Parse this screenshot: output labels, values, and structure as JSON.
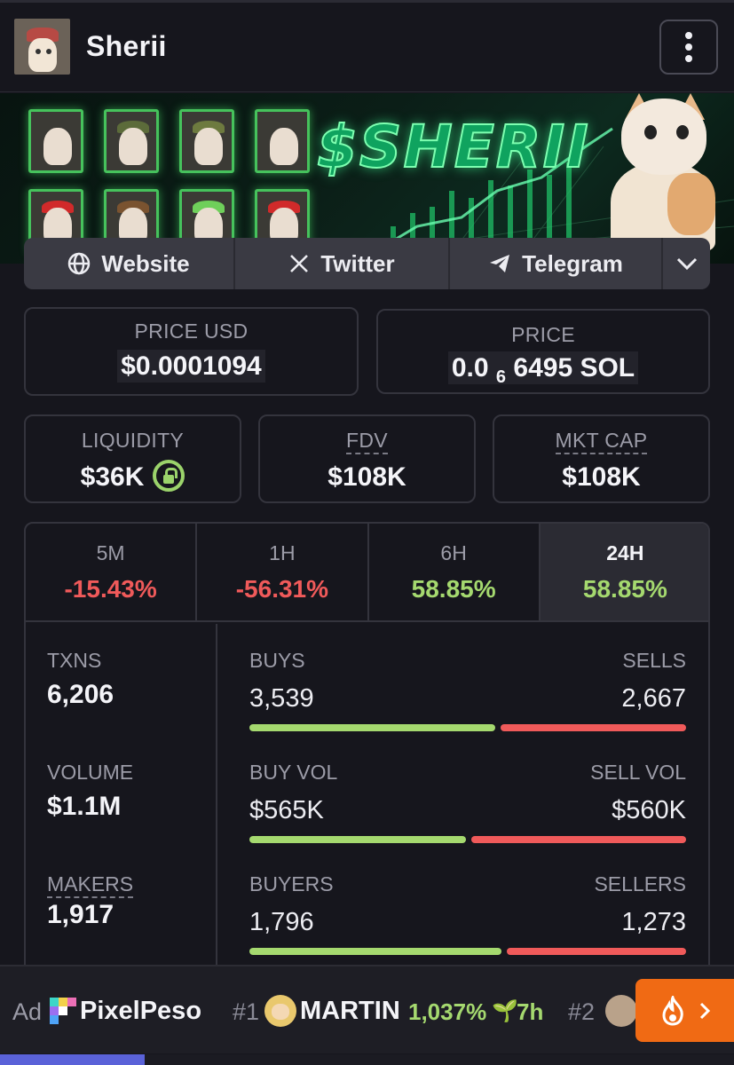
{
  "header": {
    "title": "Sherii"
  },
  "banner": {
    "logo_text": "$SHERII"
  },
  "links": {
    "website": "Website",
    "twitter": "Twitter",
    "telegram": "Telegram"
  },
  "price_usd": {
    "label": "PRICE USD",
    "value": "$0.0001094"
  },
  "price": {
    "label": "PRICE",
    "value_prefix": "0.0",
    "subscript": "6",
    "value_suffix": "6495 SOL"
  },
  "liquidity": {
    "label": "LIQUIDITY",
    "value": "$36K"
  },
  "fdv": {
    "label": "FDV",
    "value": "$108K"
  },
  "mkt_cap": {
    "label": "MKT CAP",
    "value": "$108K"
  },
  "changes": [
    {
      "label": "5M",
      "value": "-15.43%",
      "color": "#f05a5a"
    },
    {
      "label": "1H",
      "value": "-56.31%",
      "color": "#f05a5a"
    },
    {
      "label": "6H",
      "value": "58.85%",
      "color": "#a5d96f"
    },
    {
      "label": "24H",
      "value": "58.85%",
      "color": "#a5d96f"
    }
  ],
  "active_tab": "24H",
  "stats": {
    "txns": {
      "label": "TXNS",
      "value": "6,206"
    },
    "volume": {
      "label": "VOLUME",
      "value": "$1.1M"
    },
    "makers": {
      "label": "MAKERS",
      "value": "1,917"
    }
  },
  "splits": {
    "txns": {
      "left_label": "BUYS",
      "right_label": "SELLS",
      "left_value": "3,539",
      "right_value": "2,667",
      "buy_fraction": 0.57
    },
    "volume": {
      "left_label": "BUY VOL",
      "right_label": "SELL VOL",
      "left_value": "$565K",
      "right_value": "$560K",
      "buy_fraction": 0.502
    },
    "makers": {
      "left_label": "BUYERS",
      "right_label": "SELLERS",
      "left_value": "1,796",
      "right_value": "1,273",
      "buy_fraction": 0.585
    }
  },
  "ticker": {
    "ad_label": "Ad",
    "ad_name": "PixelPeso",
    "rank1": "#1",
    "name1": "MARTIN",
    "pct1": "1,037%",
    "time1": "7h",
    "rank2": "#2"
  },
  "colors": {
    "accent_green": "#a5d96f",
    "accent_red": "#f05a5a",
    "hot": "#f06a14"
  }
}
